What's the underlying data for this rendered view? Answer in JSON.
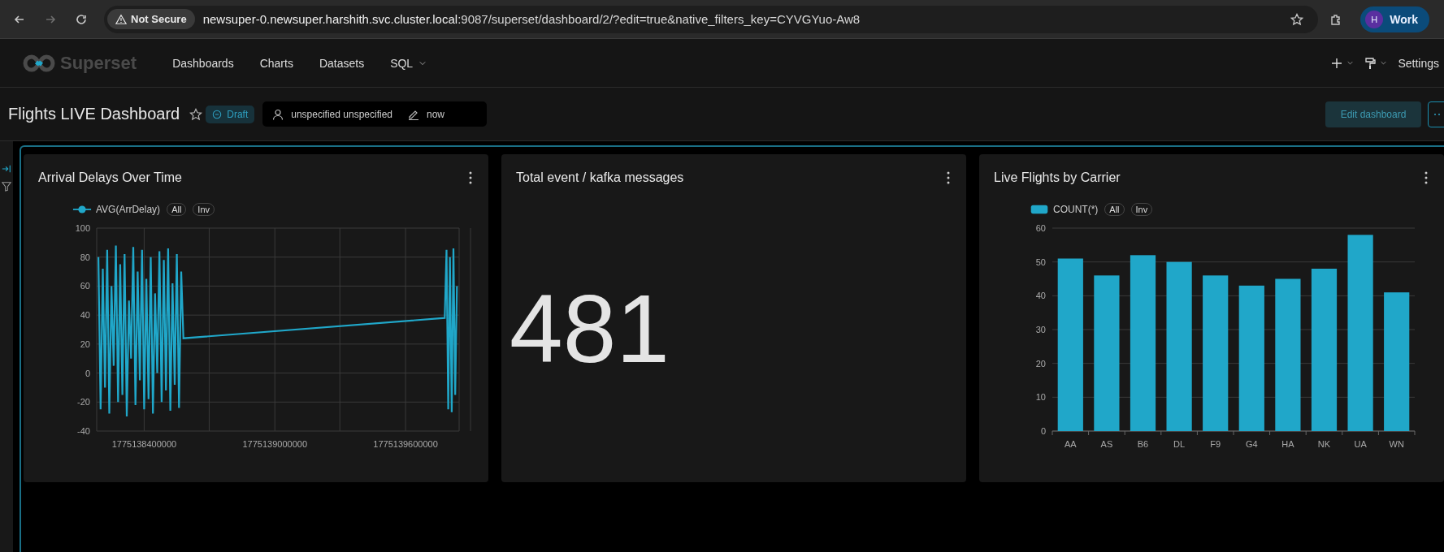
{
  "browser": {
    "security": "Not Secure",
    "url_host": "newsuper-0.newsuper.harshith.svc.cluster.local",
    "url_rest": ":9087/superset/dashboard/2/?edit=true&native_filters_key=CYVGYuo-Aw8",
    "profile": {
      "initial": "H",
      "label": "Work"
    }
  },
  "navbar": {
    "brand": "Superset",
    "items": [
      {
        "label": "Dashboards",
        "dropdown": false
      },
      {
        "label": "Charts",
        "dropdown": false
      },
      {
        "label": "Datasets",
        "dropdown": false
      },
      {
        "label": "SQL",
        "dropdown": true
      }
    ],
    "settings": "Settings"
  },
  "header": {
    "title": "Flights LIVE Dashboard",
    "favorite": false,
    "status": "Draft",
    "owner": "unspecified unspecified",
    "modified": "now",
    "edit_button": "Edit dashboard"
  },
  "charts": [
    {
      "kind": "line",
      "title": "Arrival Delays Over Time",
      "legend": [
        "All",
        "Inv"
      ],
      "chart_data": {
        "type": "line",
        "xlim": [
          1775138182000,
          1775139846000
        ],
        "ylim": [
          -40,
          100
        ],
        "xticks": [
          1775138400000,
          1775139000000,
          1775139600000
        ],
        "grid": true,
        "yticks": [
          -40,
          -20,
          0,
          20,
          40,
          60,
          80,
          100
        ],
        "x": [
          1775138190000,
          1775138200000,
          1775138210000,
          1775138220000,
          1775138230000,
          1775138240000,
          1775138250000,
          1775138260000,
          1775138270000,
          1775138280000,
          1775138290000,
          1775138300000,
          1775138310000,
          1775138320000,
          1775138330000,
          1775138340000,
          1775138350000,
          1775138360000,
          1775138370000,
          1775138380000,
          1775138390000,
          1775138400000,
          1775138410000,
          1775138420000,
          1775138430000,
          1775138440000,
          1775138450000,
          1775138460000,
          1775138470000,
          1775138480000,
          1775138490000,
          1775138500000,
          1775138510000,
          1775138520000,
          1775138530000,
          1775138540000,
          1775138550000,
          1775138560000,
          1775138570000,
          1775138580000,
          1775139780000,
          1775139788000,
          1775139796000,
          1775139804000,
          1775139812000,
          1775139820000,
          1775139828000,
          1775139836000
        ],
        "series": [
          {
            "name": "AVG(ArrDelay)",
            "color": "#20a7c9",
            "values": [
              80,
              -25,
              72,
              -10,
              85,
              -28,
              60,
              5,
              88,
              -20,
              75,
              -15,
              82,
              -30,
              50,
              10,
              87,
              -22,
              70,
              -5,
              85,
              -25,
              65,
              -18,
              80,
              -28,
              55,
              0,
              84,
              -20,
              78,
              -12,
              86,
              -26,
              62,
              -8,
              82,
              -24,
              70,
              24,
              38,
              85,
              -25,
              80,
              -27,
              86,
              -15,
              60
            ]
          }
        ]
      }
    },
    {
      "kind": "big_number",
      "title": "Total event / kafka messages",
      "value": "481"
    },
    {
      "kind": "bar",
      "title": "Live Flights by Carrier",
      "legend": [
        "All",
        "Inv"
      ],
      "chart_data": {
        "type": "bar",
        "categories": [
          "AA",
          "AS",
          "B6",
          "DL",
          "F9",
          "G4",
          "HA",
          "NK",
          "UA",
          "WN"
        ],
        "ylim": [
          0,
          60
        ],
        "grid": true,
        "yticks": [
          0,
          10,
          20,
          30,
          40,
          50,
          60
        ],
        "series": [
          {
            "name": "COUNT(*)",
            "color": "#20a7c9",
            "values": [
              51,
              46,
              52,
              50,
              46,
              43,
              45,
              48,
              58,
              41
            ]
          }
        ]
      }
    }
  ]
}
